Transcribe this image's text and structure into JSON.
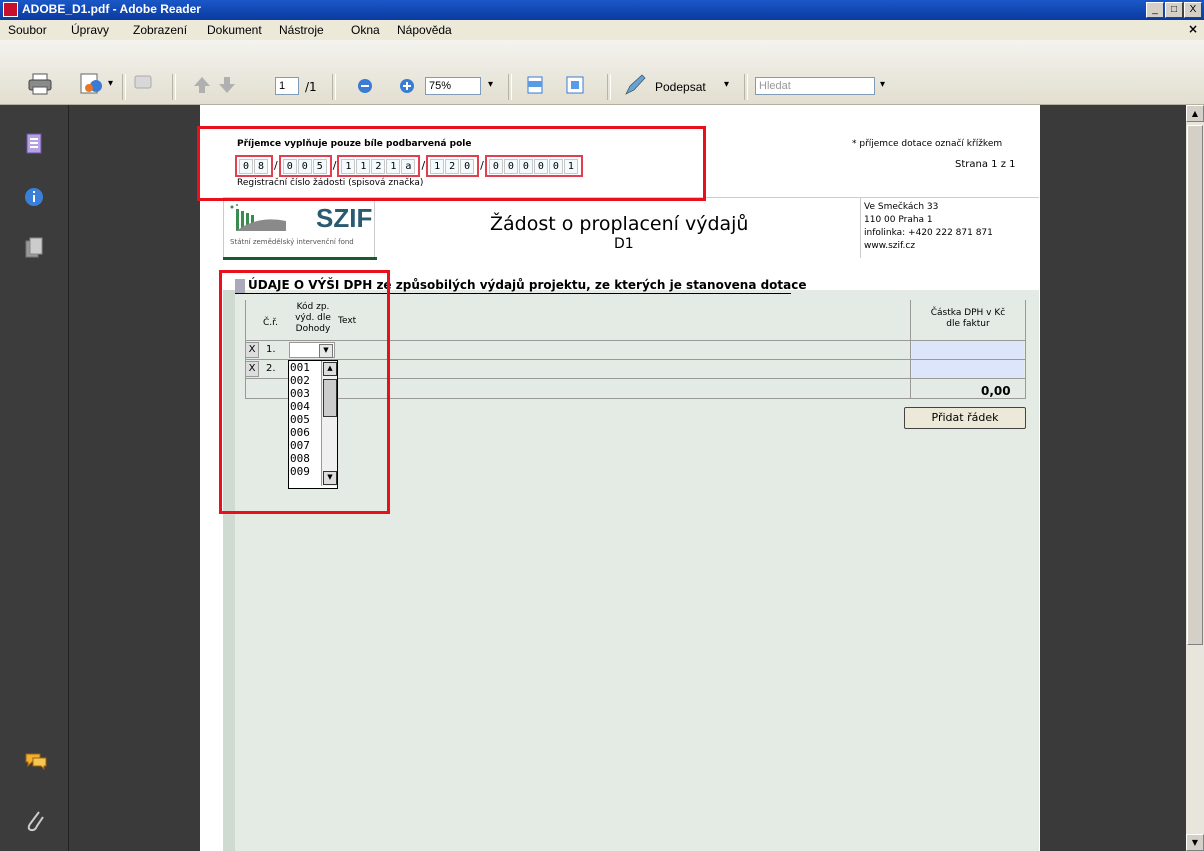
{
  "window": {
    "title": "ADOBE_D1.pdf - Adobe Reader",
    "min": "_",
    "max": "□",
    "close": "X"
  },
  "menu": {
    "items": [
      "Soubor",
      "Úpravy",
      "Zobrazení",
      "Dokument",
      "Nástroje",
      "Okna",
      "Nápověda"
    ],
    "close_doc": "×"
  },
  "toolbar": {
    "page_current": "1",
    "page_total": "/1",
    "zoom": "75%",
    "sign_label": "Podepsat",
    "search_placeholder": "Hledat"
  },
  "form": {
    "header_instruction": "Příjemce vyplňuje pouze bíle podbarvená pole",
    "mark_note": "* příjemce dotace označí křížkem",
    "page_info": "Strana 1 z 1",
    "reg_label": "Registrační číslo žádosti (spisová značka)",
    "reg_groups": [
      [
        "0",
        "8"
      ],
      [
        "0",
        "0",
        "5"
      ],
      [
        "1",
        "1",
        "2",
        "1",
        "a"
      ],
      [
        "1",
        "2",
        "0"
      ],
      [
        "0",
        "0",
        "0",
        "0",
        "0",
        "1"
      ]
    ],
    "logo_text": "SZIF",
    "logo_sub": "Státní zemědělský intervenční fond",
    "doc_title": "Žádost o proplacení výdajů",
    "doc_code": "D1",
    "address": [
      "Ve Smečkách 33",
      "110 00 Praha 1",
      "infolinka: +420 222 871 871",
      "www.szif.cz"
    ],
    "section_title": "ÚDAJE O VÝŠI DPH ze způsobilých výdajů projektu, ze kterých je stanovena dotace",
    "col_cr": "Č.ř.",
    "col_kod": [
      "Kód zp.",
      "výd. dle",
      "Dohody"
    ],
    "col_text": "Text",
    "col_amount": [
      "Částka DPH v Kč",
      "dle faktur"
    ],
    "rows": [
      {
        "x": "X",
        "num": "1."
      },
      {
        "x": "X",
        "num": "2."
      }
    ],
    "total": "0,00",
    "add_row": "Přidat řádek",
    "dropdown_items": [
      "001",
      "002",
      "003",
      "004",
      "005",
      "006",
      "007",
      "008",
      "009"
    ]
  }
}
